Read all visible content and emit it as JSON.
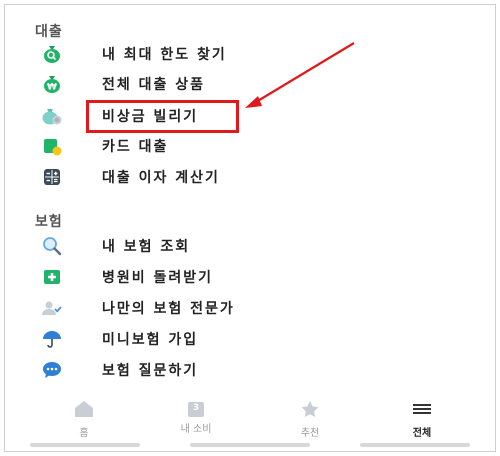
{
  "loan": {
    "title": "대출",
    "items": [
      {
        "label": "내 최대 한도 찾기",
        "icon": "money-bag-search-icon"
      },
      {
        "label": "전체 대출 상품",
        "icon": "money-bag-won-icon"
      },
      {
        "label": "비상금 빌리기",
        "icon": "coin-bag-icon"
      },
      {
        "label": "카드 대출",
        "icon": "card-coin-icon"
      },
      {
        "label": "대출 이자 계산기",
        "icon": "calculator-icon"
      }
    ]
  },
  "insurance": {
    "title": "보험",
    "items": [
      {
        "label": "내 보험 조회",
        "icon": "magnifier-icon"
      },
      {
        "label": "병원비 돌려받기",
        "icon": "medical-cross-icon"
      },
      {
        "label": "나만의 보험 전문가",
        "icon": "person-check-icon"
      },
      {
        "label": "미니보험 가입",
        "icon": "umbrella-icon"
      },
      {
        "label": "보험 질문하기",
        "icon": "chat-bubble-icon"
      }
    ]
  },
  "tabs": [
    {
      "label": "홈",
      "icon": "home-icon"
    },
    {
      "label": "내 소비",
      "icon": "calendar-icon",
      "badge": "3"
    },
    {
      "label": "추천",
      "icon": "star-icon"
    },
    {
      "label": "전체",
      "icon": "menu-icon"
    }
  ],
  "colors": {
    "accent": "#1aa35c",
    "highlight": "#e01a1a"
  }
}
